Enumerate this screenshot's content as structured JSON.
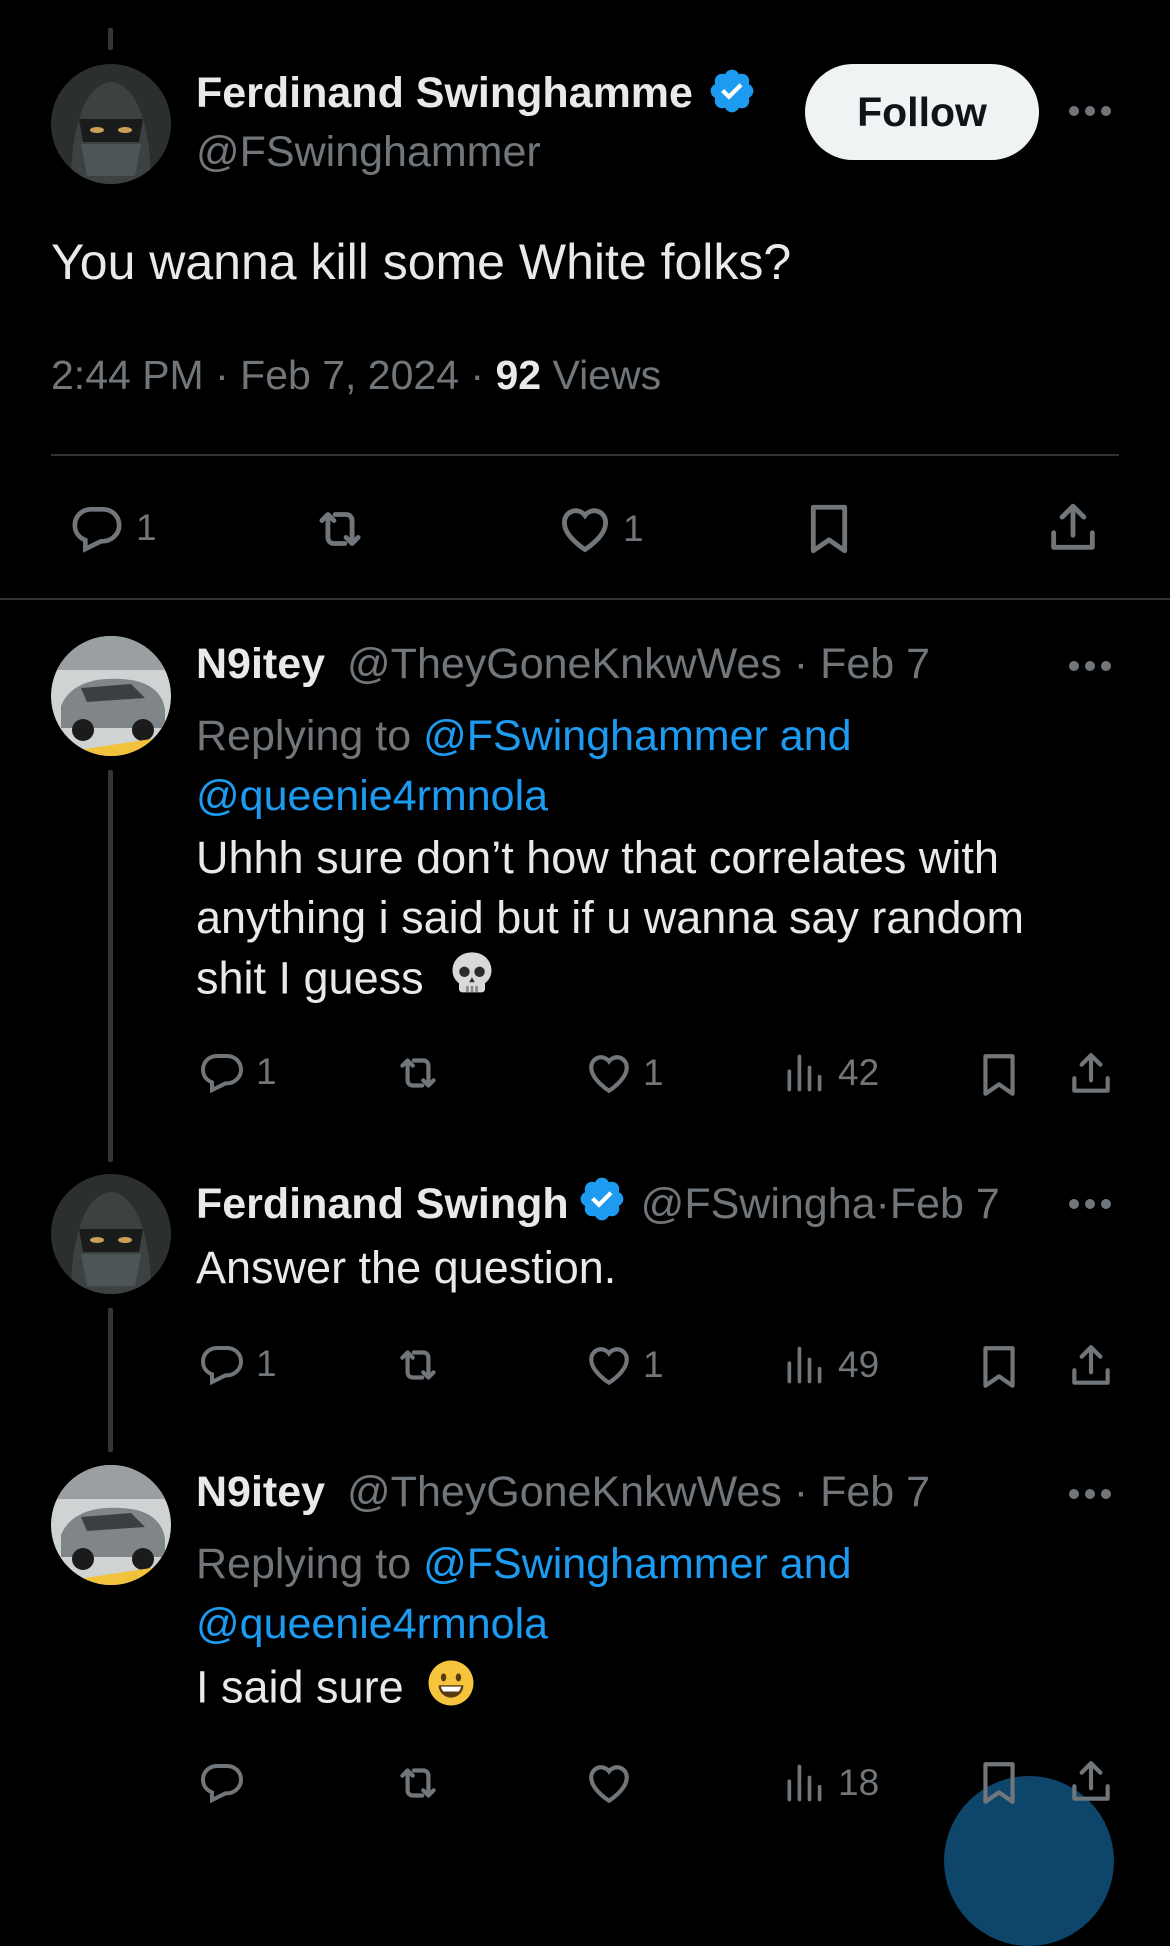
{
  "main_tweet": {
    "author_name": "Ferdinand Swinghamme",
    "author_handle": "@FSwinghammer",
    "follow_label": "Follow",
    "text": "You wanna kill some White folks?",
    "time": "2:44 PM",
    "date": "Feb 7, 2024",
    "views_count": "92",
    "views_label": "Views",
    "reply_count": "1",
    "like_count": "1",
    "verified": true
  },
  "replies": [
    {
      "author_name": "N9itey",
      "author_handle": "@TheyGoneKnkwWes",
      "date": "Feb 7",
      "replying_prefix": "Replying to",
      "replying_line1": "@FSwinghammer and",
      "replying_line2": "@queenie4rmnola",
      "text_line1": "Uhhh sure don’t how that correlates with",
      "text_line2": "anything i said but if u wanna say random",
      "text_line3": "shit I guess",
      "emoji": "skull-emoji",
      "reply_count": "1",
      "like_count": "1",
      "views": "42"
    },
    {
      "author_name": "Ferdinand Swingh",
      "author_handle": "@FSwingha",
      "date": "Feb 7",
      "text": "Answer the question.",
      "reply_count": "1",
      "like_count": "1",
      "views": "49",
      "verified": true
    },
    {
      "author_name": "N9itey",
      "author_handle": "@TheyGoneKnkwWes",
      "date": "Feb 7",
      "replying_prefix": "Replying to",
      "replying_line1": "@FSwinghammer and",
      "replying_line2": "@queenie4rmnola",
      "text": "I said sure",
      "emoji": "grinning-face-emoji",
      "views": "18"
    }
  ],
  "colors": {
    "background": "#000000",
    "text": "#e7e9ea",
    "muted": "#71767b",
    "accent": "#1d9bf0",
    "divider": "#2f3336"
  }
}
